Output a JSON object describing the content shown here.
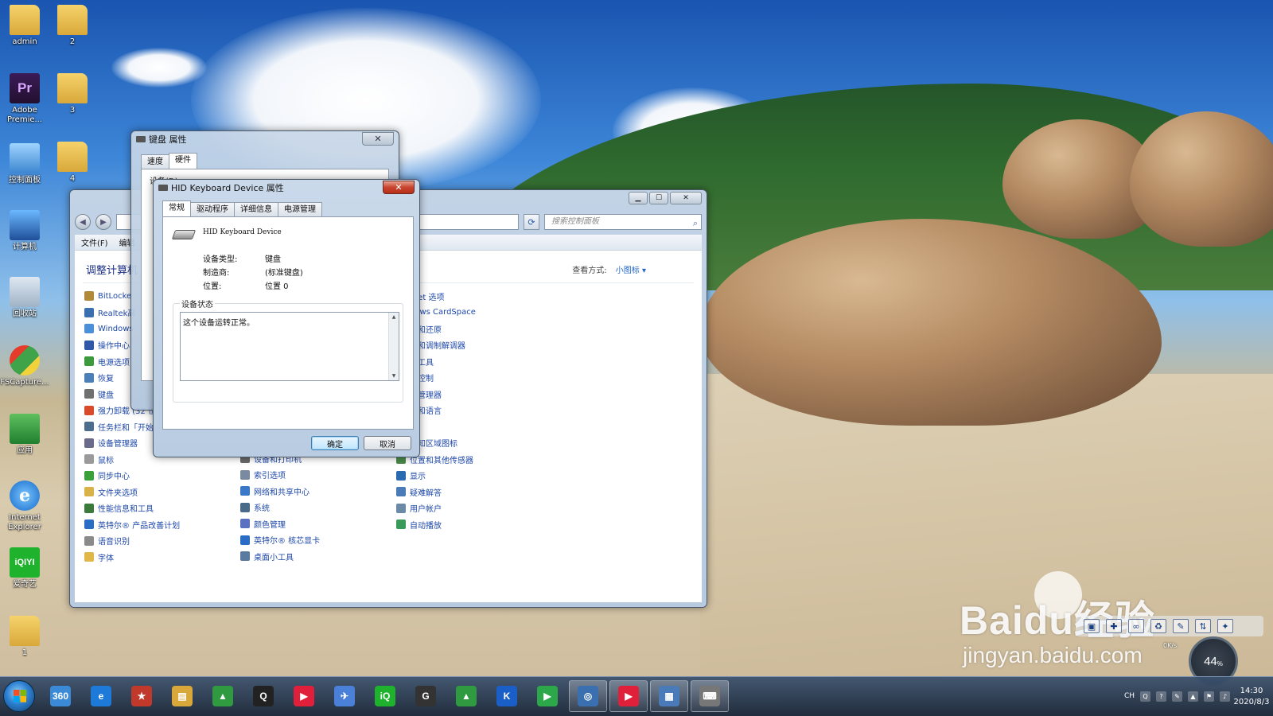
{
  "desktop": {
    "icons": [
      {
        "label": "admin",
        "icon": "user-folder-icon"
      },
      {
        "label": "2",
        "icon": "folder-icon"
      },
      {
        "label": "Adobe Premie...",
        "icon": "adobe-premiere-icon"
      },
      {
        "label": "3",
        "icon": "folder-icon"
      },
      {
        "label": "控制面板",
        "icon": "control-panel-icon"
      },
      {
        "label": "4",
        "icon": "folder-icon"
      },
      {
        "label": "计算机",
        "icon": "computer-icon"
      },
      {
        "label": "回收站",
        "icon": "recycle-bin-icon"
      },
      {
        "label": "FSCapture...",
        "icon": "fscapture-icon"
      },
      {
        "label": "应用",
        "icon": "app-icon"
      },
      {
        "label": "Internet Explorer",
        "icon": "ie-icon"
      },
      {
        "label": "爱奇艺",
        "icon": "iqiyi-icon"
      },
      {
        "label": "1",
        "icon": "folder-icon"
      }
    ]
  },
  "control_panel": {
    "menu": [
      "文件(F)",
      "编辑"
    ],
    "search_placeholder": "搜索控制面板",
    "heading": "调整计算机",
    "view_by_label": "查看方式:",
    "view_by_value": "小图标 ▾",
    "col1": [
      "BitLocke",
      "Realtek高",
      "Windows",
      "操作中心",
      "电源选项",
      "恢复",
      "键盘",
      "强力卸载 (32 位",
      "任务栏和「开始",
      "设备管理器",
      "鼠标",
      "同步中心",
      "文件夹选项",
      "性能信息和工具",
      "英特尔® 产品改善计划",
      "语音识别",
      "字体"
    ],
    "col2": [
      "设备和打印机",
      "索引选项",
      "网络和共享中心",
      "系统",
      "颜色管理",
      "英特尔® 核芯显卡",
      "桌面小工具"
    ],
    "col3": [
      "rnet 选项",
      "dows CardSpace",
      "份和还原",
      "话和调制解调器",
      "理工具",
      "户控制",
      "据管理器",
      "域和语言",
      "体",
      "通知区域图标",
      "位置和其他传感器",
      "显示",
      "疑难解答",
      "用户帐户",
      "自动播放"
    ]
  },
  "keyboard_props": {
    "title": "键盘 属性",
    "tabs": [
      "速度",
      "硬件"
    ],
    "panel_label": "设备(D):"
  },
  "hid_dialog": {
    "title": "HID Keyboard Device 属性",
    "tabs": [
      "常规",
      "驱动程序",
      "详细信息",
      "电源管理"
    ],
    "device_name": "HID Keyboard Device",
    "device_type_label": "设备类型:",
    "device_type_value": "键盘",
    "manufacturer_label": "制造商:",
    "manufacturer_value": "(标准键盘)",
    "location_label": "位置:",
    "location_value": "位置 0",
    "status_group_label": "设备状态",
    "status_text": "这个设备运转正常。",
    "ok_label": "确定",
    "cancel_label": "取消"
  },
  "watermark": {
    "brand": "Baidu经验",
    "url": "jingyan.baidu.com"
  },
  "widget": {
    "meter_value": "44",
    "meter_unit": "%",
    "net_up": "0",
    "net_unit": "K/s"
  },
  "taskbar": {
    "pinned": [
      {
        "name": "browser-360-icon",
        "label": "360"
      },
      {
        "name": "ie-icon",
        "label": "e"
      },
      {
        "name": "app-red-icon",
        "label": "★"
      },
      {
        "name": "file-explorer-icon",
        "label": "▤"
      },
      {
        "name": "app-green-icon",
        "label": "▲"
      },
      {
        "name": "qq-icon",
        "label": "Q"
      },
      {
        "name": "youku-icon",
        "label": "▶"
      },
      {
        "name": "feiq-icon",
        "label": "✈"
      },
      {
        "name": "iqiyi-icon",
        "label": "iQ"
      },
      {
        "name": "app-g-icon",
        "label": "G"
      },
      {
        "name": "app-green2-icon",
        "label": "▲"
      },
      {
        "name": "kugou-icon",
        "label": "K"
      },
      {
        "name": "player-icon",
        "label": "▶"
      },
      {
        "name": "capture-icon",
        "label": "◎"
      },
      {
        "name": "youku2-icon",
        "label": "▶"
      },
      {
        "name": "control-panel-icon",
        "label": "▦"
      },
      {
        "name": "keyboard-icon",
        "label": "⌨"
      }
    ],
    "tray_lang": "CH",
    "time": "14:30",
    "date": "2020/8/3"
  }
}
